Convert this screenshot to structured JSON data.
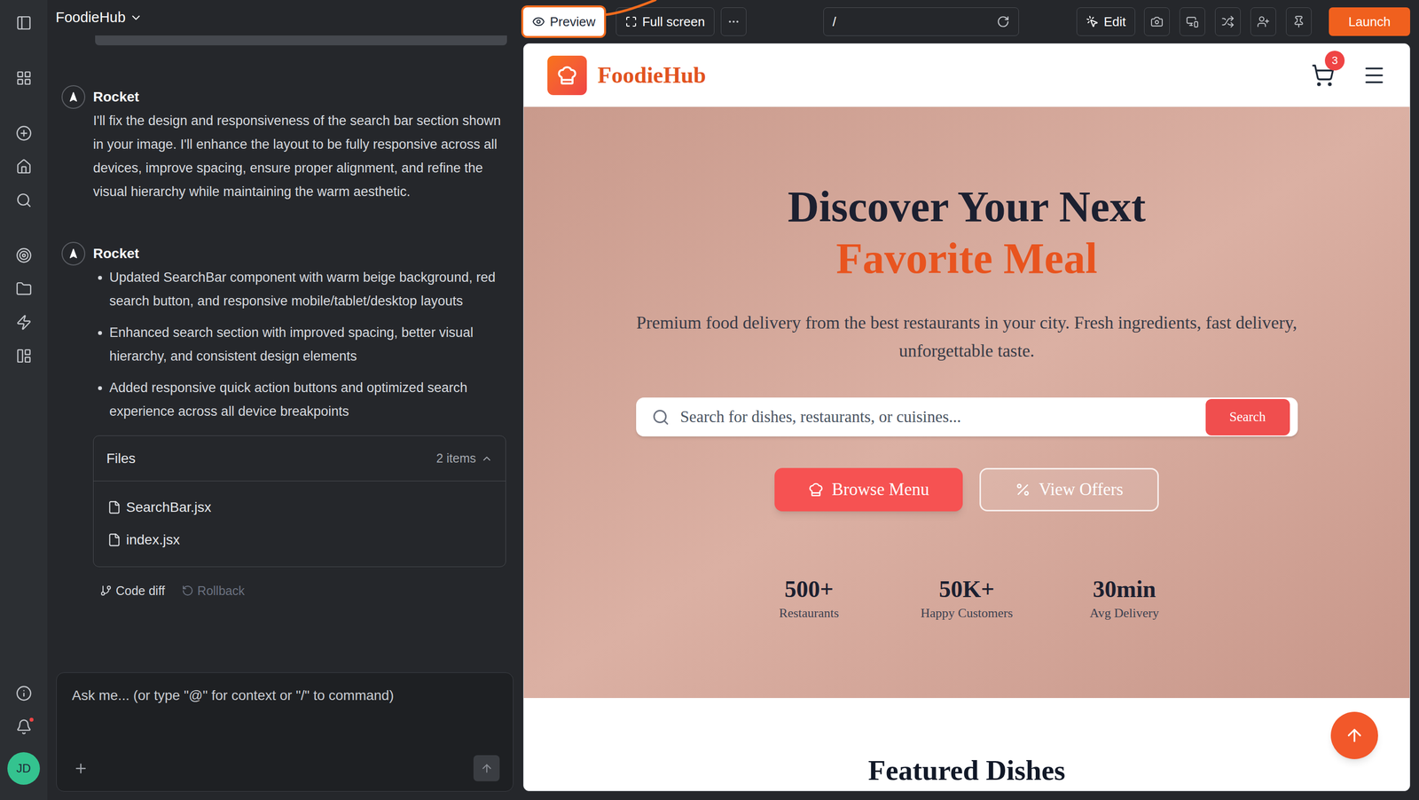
{
  "app": {
    "title": "FoodieHub"
  },
  "rail": {
    "notifications_unread": true,
    "user_initials": "JD"
  },
  "toolbar": {
    "modes": [
      {
        "label": "Preview",
        "selected": true
      },
      {
        "label": "Full screen",
        "selected": false
      }
    ],
    "url": "/",
    "edit": "Edit",
    "launch": "Launch"
  },
  "chat": {
    "messages": [
      {
        "author": "Rocket",
        "kind": "text",
        "text": "I'll fix the design and responsiveness of the search bar section shown in your image. I'll enhance the layout to be fully responsive across all devices, improve spacing, ensure proper alignment, and refine the visual hierarchy while maintaining the warm aesthetic."
      },
      {
        "author": "Rocket",
        "kind": "bullets",
        "items": [
          "Updated SearchBar component with warm beige background, red search button, and responsive mobile/tablet/desktop layouts",
          "Enhanced search section with improved spacing, better visual hierarchy, and consistent design elements",
          "Added responsive quick action buttons and optimized search experience across all device breakpoints"
        ]
      }
    ],
    "files": {
      "title": "Files",
      "count": "2 items",
      "expanded": true,
      "items": [
        "SearchBar.jsx",
        "index.jsx"
      ]
    },
    "actions": [
      {
        "label": "Code diff",
        "disabled": false
      },
      {
        "label": "Rollback",
        "disabled": true
      }
    ],
    "input_placeholder": "Ask me... (or type \"@\" for context or \"/\" to command)"
  },
  "preview": {
    "brand": "FoodieHub",
    "cart_count": "3",
    "hero": {
      "title_line1": "Discover Your Next",
      "title_line2": "Favorite Meal",
      "subtitle": "Premium food delivery from the best restaurants in your city. Fresh ingredients, fast delivery, unforgettable taste.",
      "search_placeholder": "Search for dishes, restaurants, or cuisines...",
      "search_button": "Search",
      "actions": [
        {
          "label": "Browse Menu",
          "kind": "primary"
        },
        {
          "label": "View Offers",
          "kind": "outline"
        }
      ],
      "stats": [
        {
          "value": "500+",
          "label": "Restaurants"
        },
        {
          "value": "50K+",
          "label": "Happy Customers"
        },
        {
          "value": "30min",
          "label": "Avg Delivery"
        }
      ]
    },
    "section_title": "Featured Dishes"
  }
}
